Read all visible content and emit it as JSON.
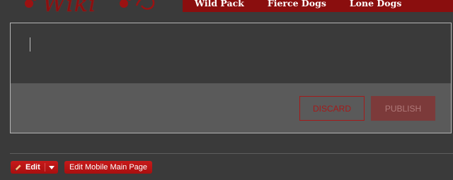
{
  "logo": {
    "text": "Wiki"
  },
  "nav": {
    "items": [
      "Wild Pack",
      "Fierce Dogs",
      "Lone Dogs"
    ]
  },
  "editor": {
    "value": "",
    "discard_label": "DISCARD",
    "publish_label": "PUBLISH"
  },
  "actions": {
    "edit_label": "Edit",
    "mobile_label": "Edit Mobile Main Page"
  },
  "colors": {
    "accent": "#8a0e0e",
    "button": "#b81414",
    "background": "#3a3a3a"
  },
  "icons": [
    "paw-icon",
    "pencil-icon",
    "caret-down-icon"
  ]
}
